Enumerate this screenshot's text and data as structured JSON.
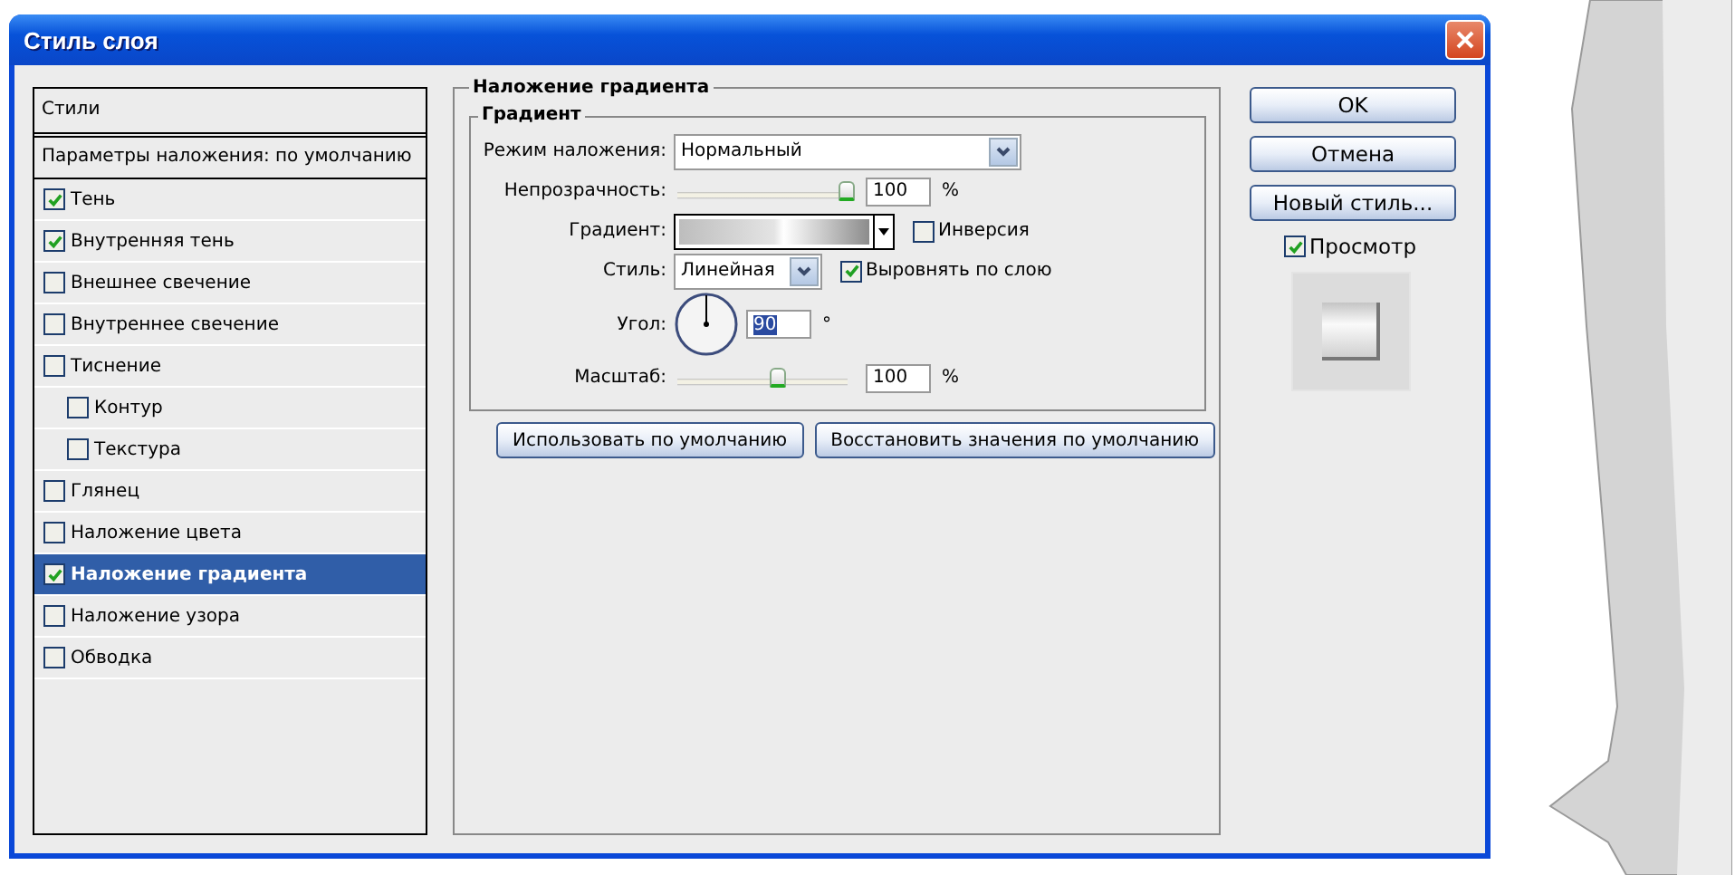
{
  "window": {
    "title": "Стиль слоя"
  },
  "styles_panel": {
    "header": "Стили",
    "blending_options": "Параметры наложения: по умолчанию",
    "items": [
      {
        "label": "Тень",
        "checked": true,
        "selected": false
      },
      {
        "label": "Внутренняя тень",
        "checked": true,
        "selected": false
      },
      {
        "label": "Внешнее свечение",
        "checked": false,
        "selected": false
      },
      {
        "label": "Внутреннее свечение",
        "checked": false,
        "selected": false
      },
      {
        "label": "Тиснение",
        "checked": false,
        "selected": false,
        "children": [
          {
            "label": "Контур",
            "checked": false,
            "selected": false
          },
          {
            "label": "Текстура",
            "checked": false,
            "selected": false
          }
        ]
      },
      {
        "label": "Глянец",
        "checked": false,
        "selected": false
      },
      {
        "label": "Наложение цвета",
        "checked": false,
        "selected": false
      },
      {
        "label": "Наложение градиента",
        "checked": true,
        "selected": true
      },
      {
        "label": "Наложение узора",
        "checked": false,
        "selected": false
      },
      {
        "label": "Обводка",
        "checked": false,
        "selected": false
      }
    ]
  },
  "gradient_overlay": {
    "section_title": "Наложение градиента",
    "group_title": "Градиент",
    "blend_mode": {
      "label": "Режим наложения:",
      "value": "Нормальный"
    },
    "opacity": {
      "label": "Непрозрачность:",
      "value": "100",
      "unit": "%",
      "level": 1
    },
    "gradient": {
      "label": "Градиент:"
    },
    "reverse": {
      "label": "Инверсия",
      "checked": false
    },
    "style": {
      "label": "Стиль:",
      "value": "Линейная"
    },
    "align": {
      "label": "Выровнять по слою",
      "checked": true
    },
    "angle": {
      "label": "Угол:",
      "value": "90",
      "unit": "°"
    },
    "scale": {
      "label": "Масштаб:",
      "value": "100",
      "unit": "%",
      "level": 0.6
    },
    "buttons": [
      "Использовать по умолчанию",
      "Восстановить значения по умолчанию"
    ]
  },
  "actions": {
    "buttons": [
      "OK",
      "Отмена",
      "Новый стиль..."
    ],
    "preview": {
      "label": "Просмотр",
      "checked": true
    }
  }
}
